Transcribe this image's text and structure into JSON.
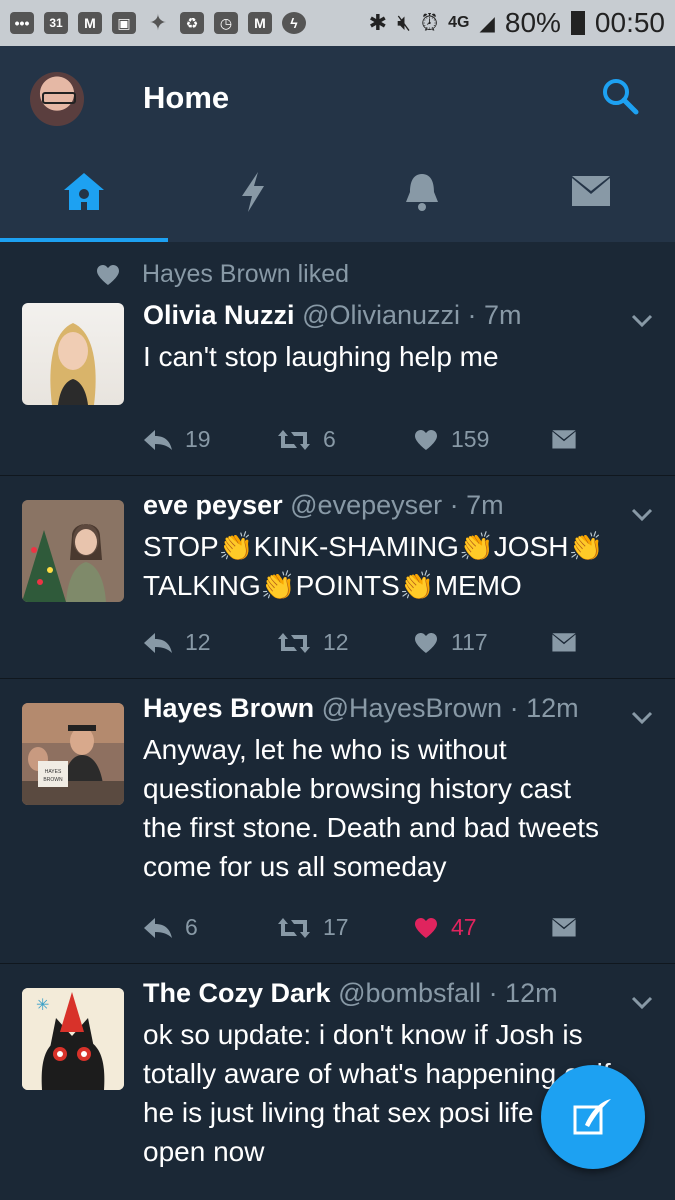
{
  "status_bar": {
    "date_icon": "31",
    "network": "4G",
    "battery": "80%",
    "time": "00:50",
    "icons": [
      "more-icon",
      "calendar-icon",
      "gmail-icon",
      "gallery-icon",
      "twitter-icon",
      "recycle-icon",
      "tasks-icon",
      "mail-icon",
      "messenger-icon",
      "bluetooth-icon",
      "mute-icon",
      "alarm-icon",
      "signal-icon",
      "battery-icon"
    ]
  },
  "header": {
    "title": "Home",
    "tabs": [
      {
        "name": "home",
        "icon": "home-icon",
        "active": true
      },
      {
        "name": "moments",
        "icon": "lightning-icon",
        "active": false
      },
      {
        "name": "notifications",
        "icon": "bell-icon",
        "active": false
      },
      {
        "name": "messages",
        "icon": "envelope-icon",
        "active": false
      }
    ]
  },
  "colors": {
    "accent": "#1da1f2",
    "header_bg": "#243447",
    "timeline_bg": "#1b2836",
    "muted": "#8899a6",
    "like": "#e0245e"
  },
  "tweets": [
    {
      "social_context": "Hayes Brown liked",
      "name": "Olivia Nuzzi",
      "handle": "@Olivianuzzi",
      "time": "· 7m",
      "text_lines": [
        "I can't stop laughing help me"
      ],
      "replies": "19",
      "retweets": "6",
      "likes": "159",
      "liked": false
    },
    {
      "name": "eve peyser",
      "handle": "@evepeyser",
      "time": "· 7m",
      "text_lines": [
        "STOP👏KINK-SHAMING👏JOSH👏",
        "TALKING👏POINTS👏MEMO"
      ],
      "replies": "12",
      "retweets": "12",
      "likes": "117",
      "liked": false
    },
    {
      "name": "Hayes Brown",
      "handle": "@HayesBrown",
      "time": "· 12m",
      "text_lines": [
        "Anyway, let he who is without",
        "questionable browsing history cast",
        "the first stone. Death and bad tweets",
        "come for us all someday"
      ],
      "replies": "6",
      "retweets": "17",
      "likes": "47",
      "liked": true,
      "avatar_sign": "HAYES BROWN"
    },
    {
      "name": "The Cozy Dark",
      "handle": "@bombsfall",
      "time": "· 12m",
      "text_lines": [
        "ok so update: i don't know if Josh is",
        "totally aware of what's happening or if",
        "he is just living that sex posi life",
        "open now"
      ]
    }
  ]
}
